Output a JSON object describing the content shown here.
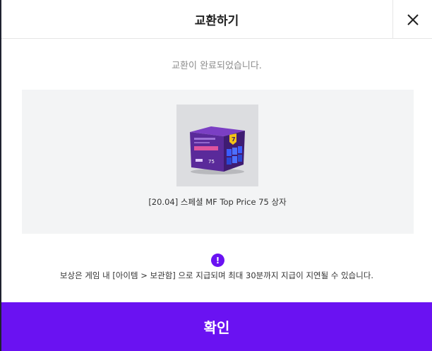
{
  "dialog": {
    "title": "교환하기",
    "close_icon": "close-icon",
    "message": "교환이 완료되었습니다.",
    "reward": {
      "name": "[20.04] 스페셜 MF Top Price 75 상자",
      "box_color": "#5a2a9a",
      "box_label": "75"
    },
    "notice": {
      "icon": "exclamation-icon",
      "icon_symbol": "!",
      "text": "보상은 게임 내 [아이템 > 보관함] 으로 지급되며 최대 30분까지 지급이 지연될 수 있습니다."
    },
    "confirm_label": "확인",
    "accent_color": "#6a12f2"
  }
}
